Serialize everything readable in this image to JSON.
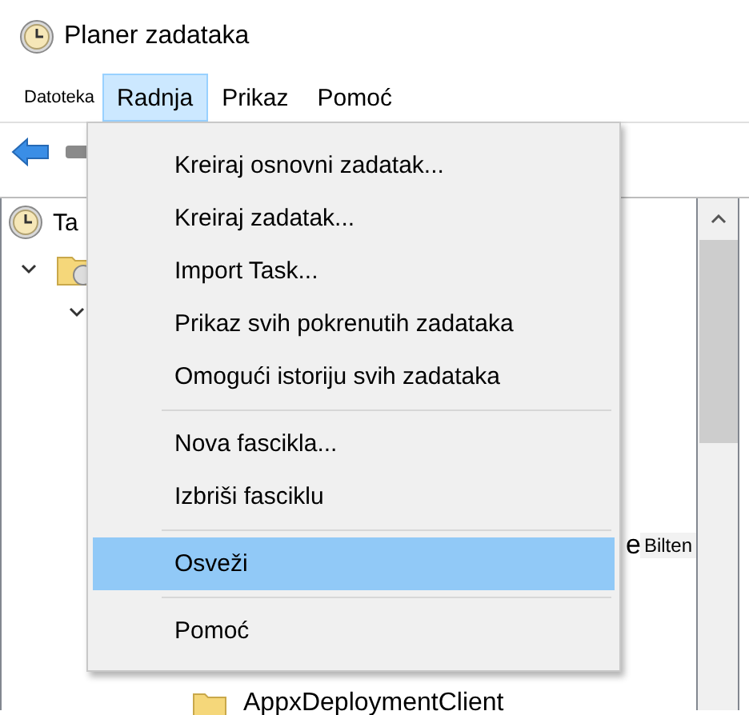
{
  "window": {
    "title": "Planer zadataka"
  },
  "menu_bar": [
    {
      "label": "Datoteka",
      "kind": "small",
      "selected": false
    },
    {
      "label": "Radnja",
      "kind": "normal",
      "selected": true
    },
    {
      "label": "Prikaz",
      "kind": "normal",
      "selected": false
    },
    {
      "label": "Pomoć",
      "kind": "normal",
      "selected": false
    }
  ],
  "tree": [
    {
      "label": "Ta",
      "children": [
        {
          "expanded": true,
          "children": [
            {
              "expanded": true
            }
          ]
        }
      ]
    }
  ],
  "tree_tail": [
    {
      "label": "e",
      "kind": "cut"
    },
    {
      "label": "AppxDeploymentClient",
      "kind": "folder"
    }
  ],
  "tooltip": "Bilten",
  "context_menu": [
    {
      "kind": "item",
      "label": "Kreiraj osnovni zadatak...",
      "selected": false
    },
    {
      "kind": "item",
      "label": "Kreiraj zadatak...",
      "selected": false
    },
    {
      "kind": "item",
      "label": "Import Task...",
      "selected": false
    },
    {
      "kind": "item",
      "label": "Prikaz svih pokrenutih zadataka",
      "selected": false
    },
    {
      "kind": "item",
      "label": "Omogući istoriju svih zadataka",
      "selected": false
    },
    {
      "kind": "separator"
    },
    {
      "kind": "item",
      "label": "Nova fascikla...",
      "selected": false
    },
    {
      "kind": "item",
      "label": "Izbriši fasciklu",
      "selected": false
    },
    {
      "kind": "separator"
    },
    {
      "kind": "item",
      "label": "Osveži",
      "selected": true
    },
    {
      "kind": "separator"
    },
    {
      "kind": "item",
      "label": "Pomoć",
      "selected": false
    }
  ]
}
